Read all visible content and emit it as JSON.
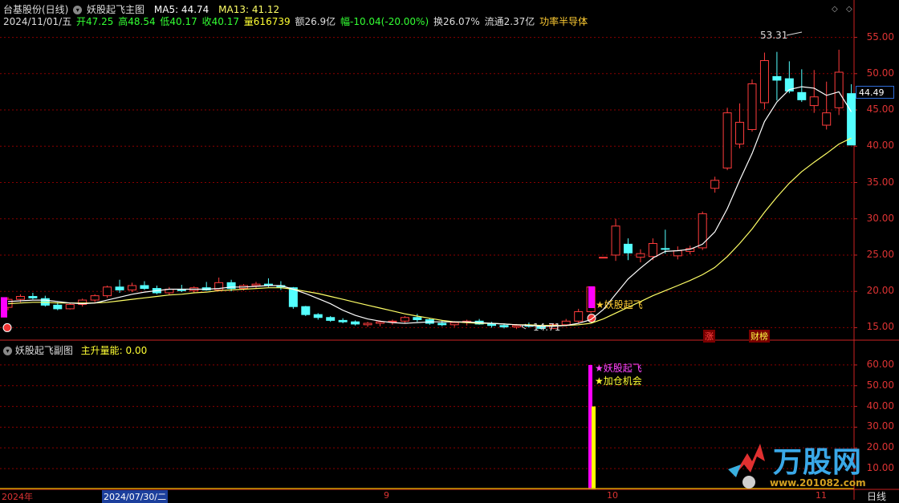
{
  "header": {
    "stock_title": "台基股份(日线)",
    "indicator_name": "妖股起飞主图",
    "ma5_label": "MA5: 44.74",
    "ma13_label": "MA13: 41.12",
    "date": "2024/11/01/五",
    "open": "开47.25",
    "high": "高48.54",
    "low": "低40.17",
    "close": "收40.17",
    "volume": "量616739",
    "amount": "额26.9亿",
    "change": "幅-10.04(-20.00%)",
    "turnover": "换26.07%",
    "float": "流通2.37亿",
    "sector": "功率半导体"
  },
  "sub_panel": {
    "title": "妖股起飞副图",
    "indicator": "主升量能: 0.00"
  },
  "price_axis": [
    "55.00",
    "50.00",
    "45.00",
    "40.00",
    "35.00",
    "30.00",
    "25.00",
    "20.00",
    "15.00"
  ],
  "volume_axis": [
    "60.00",
    "50.00",
    "40.00",
    "30.00",
    "20.00",
    "10.00"
  ],
  "current_price": "44.49",
  "annotations": {
    "high_mark": "53.31",
    "low_mark": "14.71",
    "signal_main": "★妖股起飞",
    "signal_sub1": "★妖股起飞",
    "signal_sub2": "★加仓机会",
    "tag_zhang": "涨",
    "tag_caibao": "财榜"
  },
  "time_axis": {
    "year_label": "2024年",
    "cursor_date": "2024/07/30/二",
    "m9": "9",
    "m10": "10",
    "m11": "11",
    "period": "日线"
  },
  "logo": {
    "brand": "万股网",
    "url": "www.201082.com"
  },
  "colors": {
    "up": "#ff3c3c",
    "down": "#54ffff",
    "ma5": "#ffffff",
    "ma13": "#ffff66",
    "grid": "#8b0000",
    "magenta": "#ff00ff",
    "yellow": "#ffff00"
  },
  "chart_data": {
    "type": "candlestick",
    "price_range": [
      13.5,
      56.5
    ],
    "candles": [
      {
        "o": 17.8,
        "h": 19.2,
        "l": 17.4,
        "c": 18.9
      },
      {
        "o": 18.9,
        "h": 19.6,
        "l": 18.5,
        "c": 19.3
      },
      {
        "o": 19.3,
        "h": 19.8,
        "l": 18.9,
        "c": 19.1
      },
      {
        "o": 19.0,
        "h": 19.4,
        "l": 17.9,
        "c": 18.1
      },
      {
        "o": 18.1,
        "h": 18.5,
        "l": 17.4,
        "c": 17.6
      },
      {
        "o": 17.6,
        "h": 18.4,
        "l": 17.5,
        "c": 18.2
      },
      {
        "o": 18.2,
        "h": 19.0,
        "l": 17.9,
        "c": 18.8
      },
      {
        "o": 18.8,
        "h": 19.6,
        "l": 18.5,
        "c": 19.4
      },
      {
        "o": 19.4,
        "h": 20.8,
        "l": 19.1,
        "c": 20.6
      },
      {
        "o": 20.6,
        "h": 21.6,
        "l": 19.8,
        "c": 20.2
      },
      {
        "o": 20.2,
        "h": 21.2,
        "l": 19.9,
        "c": 20.8
      },
      {
        "o": 20.8,
        "h": 21.4,
        "l": 20.2,
        "c": 20.4
      },
      {
        "o": 20.4,
        "h": 20.8,
        "l": 19.6,
        "c": 19.8
      },
      {
        "o": 19.8,
        "h": 20.6,
        "l": 19.5,
        "c": 20.3
      },
      {
        "o": 20.3,
        "h": 20.9,
        "l": 19.9,
        "c": 20.1
      },
      {
        "o": 20.1,
        "h": 20.7,
        "l": 19.8,
        "c": 20.5
      },
      {
        "o": 20.5,
        "h": 21.3,
        "l": 20.1,
        "c": 20.2
      },
      {
        "o": 20.2,
        "h": 21.9,
        "l": 20.0,
        "c": 21.2
      },
      {
        "o": 21.2,
        "h": 21.6,
        "l": 20.0,
        "c": 20.4
      },
      {
        "o": 20.4,
        "h": 21.0,
        "l": 20.1,
        "c": 20.8
      },
      {
        "o": 20.8,
        "h": 21.3,
        "l": 20.4,
        "c": 21.0
      },
      {
        "o": 21.0,
        "h": 21.8,
        "l": 20.6,
        "c": 20.8
      },
      {
        "o": 20.8,
        "h": 21.4,
        "l": 20.2,
        "c": 20.6
      },
      {
        "o": 20.5,
        "h": 20.6,
        "l": 17.6,
        "c": 17.9
      },
      {
        "o": 17.9,
        "h": 18.0,
        "l": 16.6,
        "c": 16.8
      },
      {
        "o": 16.8,
        "h": 17.0,
        "l": 16.1,
        "c": 16.4
      },
      {
        "o": 16.4,
        "h": 16.6,
        "l": 15.8,
        "c": 16.0
      },
      {
        "o": 16.0,
        "h": 16.3,
        "l": 15.6,
        "c": 15.8
      },
      {
        "o": 15.8,
        "h": 16.0,
        "l": 15.3,
        "c": 15.5
      },
      {
        "o": 15.4,
        "h": 15.8,
        "l": 15.1,
        "c": 15.6
      },
      {
        "o": 15.6,
        "h": 16.0,
        "l": 15.2,
        "c": 15.8
      },
      {
        "o": 15.8,
        "h": 16.1,
        "l": 15.4,
        "c": 15.9
      },
      {
        "o": 15.9,
        "h": 16.6,
        "l": 15.6,
        "c": 16.4
      },
      {
        "o": 16.4,
        "h": 16.9,
        "l": 15.8,
        "c": 16.1
      },
      {
        "o": 16.1,
        "h": 16.3,
        "l": 15.4,
        "c": 15.6
      },
      {
        "o": 15.6,
        "h": 16.0,
        "l": 15.2,
        "c": 15.4
      },
      {
        "o": 15.4,
        "h": 15.9,
        "l": 15.1,
        "c": 15.7
      },
      {
        "o": 15.7,
        "h": 16.1,
        "l": 15.3,
        "c": 15.9
      },
      {
        "o": 15.9,
        "h": 16.2,
        "l": 15.4,
        "c": 15.5
      },
      {
        "o": 15.5,
        "h": 15.8,
        "l": 15.0,
        "c": 15.3
      },
      {
        "o": 15.3,
        "h": 15.6,
        "l": 14.9,
        "c": 15.1
      },
      {
        "o": 15.1,
        "h": 15.5,
        "l": 14.8,
        "c": 15.3
      },
      {
        "o": 15.3,
        "h": 15.7,
        "l": 15.0,
        "c": 15.2
      },
      {
        "o": 15.2,
        "h": 15.4,
        "l": 14.71,
        "c": 14.9
      },
      {
        "o": 14.9,
        "h": 15.6,
        "l": 14.8,
        "c": 15.4
      },
      {
        "o": 15.4,
        "h": 16.2,
        "l": 15.2,
        "c": 15.9
      },
      {
        "o": 15.9,
        "h": 17.6,
        "l": 15.6,
        "c": 17.2
      },
      {
        "o": 17.2,
        "h": 20.6,
        "l": 17.0,
        "c": 20.6
      },
      {
        "o": 24.7,
        "h": 24.7,
        "l": 24.7,
        "c": 24.7
      },
      {
        "o": 25.0,
        "h": 30.0,
        "l": 24.2,
        "c": 29.0
      },
      {
        "o": 26.5,
        "h": 27.3,
        "l": 24.3,
        "c": 25.3
      },
      {
        "o": 24.7,
        "h": 25.8,
        "l": 24.0,
        "c": 25.2
      },
      {
        "o": 24.8,
        "h": 27.3,
        "l": 24.3,
        "c": 26.6
      },
      {
        "o": 25.9,
        "h": 28.5,
        "l": 25.2,
        "c": 25.8
      },
      {
        "o": 24.9,
        "h": 26.2,
        "l": 24.4,
        "c": 25.6
      },
      {
        "o": 25.5,
        "h": 26.3,
        "l": 25.1,
        "c": 25.9
      },
      {
        "o": 26.0,
        "h": 31.0,
        "l": 25.7,
        "c": 30.7
      },
      {
        "o": 34.2,
        "h": 35.8,
        "l": 33.6,
        "c": 35.3
      },
      {
        "o": 37.0,
        "h": 45.3,
        "l": 36.7,
        "c": 44.6
      },
      {
        "o": 40.3,
        "h": 45.9,
        "l": 39.7,
        "c": 43.3
      },
      {
        "o": 42.3,
        "h": 49.2,
        "l": 42.0,
        "c": 48.6
      },
      {
        "o": 46.0,
        "h": 52.9,
        "l": 45.1,
        "c": 51.8
      },
      {
        "o": 49.6,
        "h": 53.0,
        "l": 46.3,
        "c": 49.1
      },
      {
        "o": 49.3,
        "h": 51.7,
        "l": 47.3,
        "c": 47.6
      },
      {
        "o": 47.4,
        "h": 50.6,
        "l": 46.1,
        "c": 46.4
      },
      {
        "o": 45.6,
        "h": 50.5,
        "l": 44.6,
        "c": 46.8
      },
      {
        "o": 42.9,
        "h": 48.9,
        "l": 42.3,
        "c": 44.6
      },
      {
        "o": 45.3,
        "h": 53.3,
        "l": 44.3,
        "c": 50.2
      },
      {
        "o": 47.25,
        "h": 48.54,
        "l": 40.17,
        "c": 40.17
      }
    ],
    "ma5": [
      18.6,
      18.7,
      18.8,
      18.8,
      18.6,
      18.4,
      18.3,
      18.4,
      18.8,
      19.2,
      19.6,
      19.9,
      20.1,
      20.3,
      20.3,
      20.3,
      20.3,
      20.4,
      20.6,
      20.6,
      20.7,
      20.8,
      20.8,
      20.3,
      19.7,
      19.0,
      18.3,
      17.4,
      16.7,
      16.2,
      15.9,
      15.7,
      15.6,
      15.7,
      15.8,
      15.8,
      15.8,
      15.8,
      15.7,
      15.6,
      15.5,
      15.4,
      15.3,
      15.2,
      15.2,
      15.3,
      15.6,
      16.1,
      17.5,
      19.6,
      21.7,
      23.2,
      24.6,
      25.5,
      25.6,
      25.8,
      26.5,
      28.2,
      31.4,
      35.3,
      39.0,
      43.4,
      46.1,
      47.8,
      48.2,
      48.0,
      47.0,
      47.5,
      44.74
    ],
    "ma13": [
      18.3,
      18.4,
      18.5,
      18.5,
      18.4,
      18.4,
      18.4,
      18.4,
      18.5,
      18.7,
      18.9,
      19.1,
      19.3,
      19.5,
      19.6,
      19.8,
      19.9,
      20.1,
      20.2,
      20.3,
      20.4,
      20.5,
      20.5,
      20.3,
      20.0,
      19.7,
      19.3,
      18.9,
      18.5,
      18.1,
      17.7,
      17.3,
      16.9,
      16.6,
      16.3,
      16.0,
      15.8,
      15.7,
      15.6,
      15.6,
      15.5,
      15.4,
      15.4,
      15.3,
      15.3,
      15.3,
      15.4,
      15.6,
      16.2,
      17.0,
      17.8,
      18.6,
      19.4,
      20.1,
      20.8,
      21.5,
      22.3,
      23.3,
      24.8,
      26.6,
      28.6,
      30.9,
      33.0,
      34.9,
      36.5,
      37.8,
      39.0,
      40.3,
      41.12
    ],
    "volume_bars": [
      {
        "name": "妖股起飞",
        "value": 60,
        "color": "magenta"
      },
      {
        "name": "加仓机会",
        "value": 40,
        "color": "yellow"
      }
    ],
    "volume_range": [
      0,
      65
    ]
  }
}
